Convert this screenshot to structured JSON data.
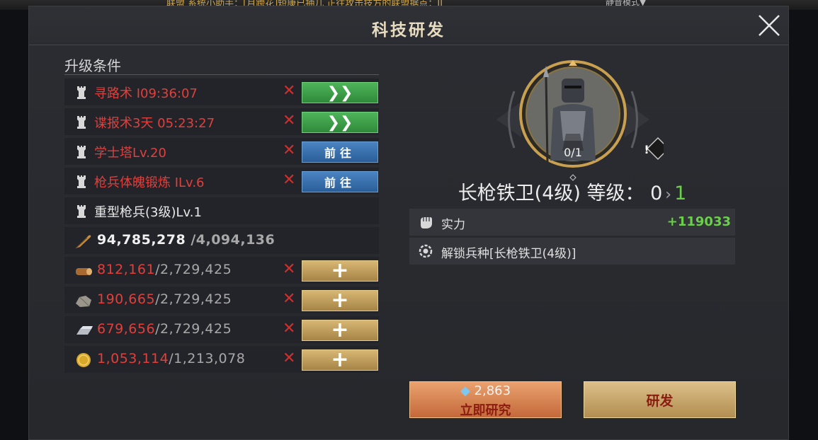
{
  "top_strip": {
    "ticker": "联盟  系统小助手：[月跨花]短康已抽几 正往攻击技方的联盟据点：II",
    "mode": "静音模式▼"
  },
  "panel": {
    "title": "科技研发"
  },
  "requirements": {
    "heading": "升级条件",
    "rows": [
      {
        "label": "寻路术 I09:36:07",
        "met": false,
        "action": "green-arrow",
        "action_label": "❯❯"
      },
      {
        "label": "谍报术3天 05:23:27",
        "met": false,
        "action": "green-arrow",
        "action_label": "❯❯"
      },
      {
        "label": "学士塔Lv.20",
        "met": false,
        "action": "goto",
        "action_label": "前往"
      },
      {
        "label": "枪兵体魄锻炼 ILv.6",
        "met": false,
        "action": "goto",
        "action_label": "前往"
      },
      {
        "label": "重型枪兵(3级)Lv.1",
        "met": true
      }
    ]
  },
  "resources": [
    {
      "icon": "feather-icon",
      "current": "94,785,278",
      "required": " /4,094,136",
      "met": true
    },
    {
      "icon": "wood-icon",
      "current": "812,161",
      "required": "/2,729,425",
      "met": false,
      "add_label": "+"
    },
    {
      "icon": "stone-icon",
      "current": "190,665",
      "required": "/2,729,425",
      "met": false,
      "add_label": "+"
    },
    {
      "icon": "iron-icon",
      "current": "679,656",
      "required": "/2,729,425",
      "met": false,
      "add_label": "+"
    },
    {
      "icon": "gold-coin-icon",
      "current": "1,053,114",
      "required": "/1,213,078",
      "met": false,
      "add_label": "+"
    }
  ],
  "unit": {
    "progress": "0/1",
    "name": "长枪铁卫(4级) 等级：",
    "level_current": "0",
    "level_next": "1",
    "stats": [
      {
        "icon": "fist-icon",
        "label": "实力",
        "value": "+119033"
      },
      {
        "icon": "gear-unlock-icon",
        "label": "解锁兵种[长枪铁卫(4级)]",
        "value": ""
      }
    ]
  },
  "actions": {
    "instant_cost": "2,863",
    "instant_label": "立即研究",
    "research_label": "研发"
  },
  "colors": {
    "unmet_red": "#e0403c",
    "positive_green": "#6ad04a",
    "gold_button": "#c9a862",
    "green_button": "#3fa04a",
    "blue_button": "#3a72b0"
  }
}
